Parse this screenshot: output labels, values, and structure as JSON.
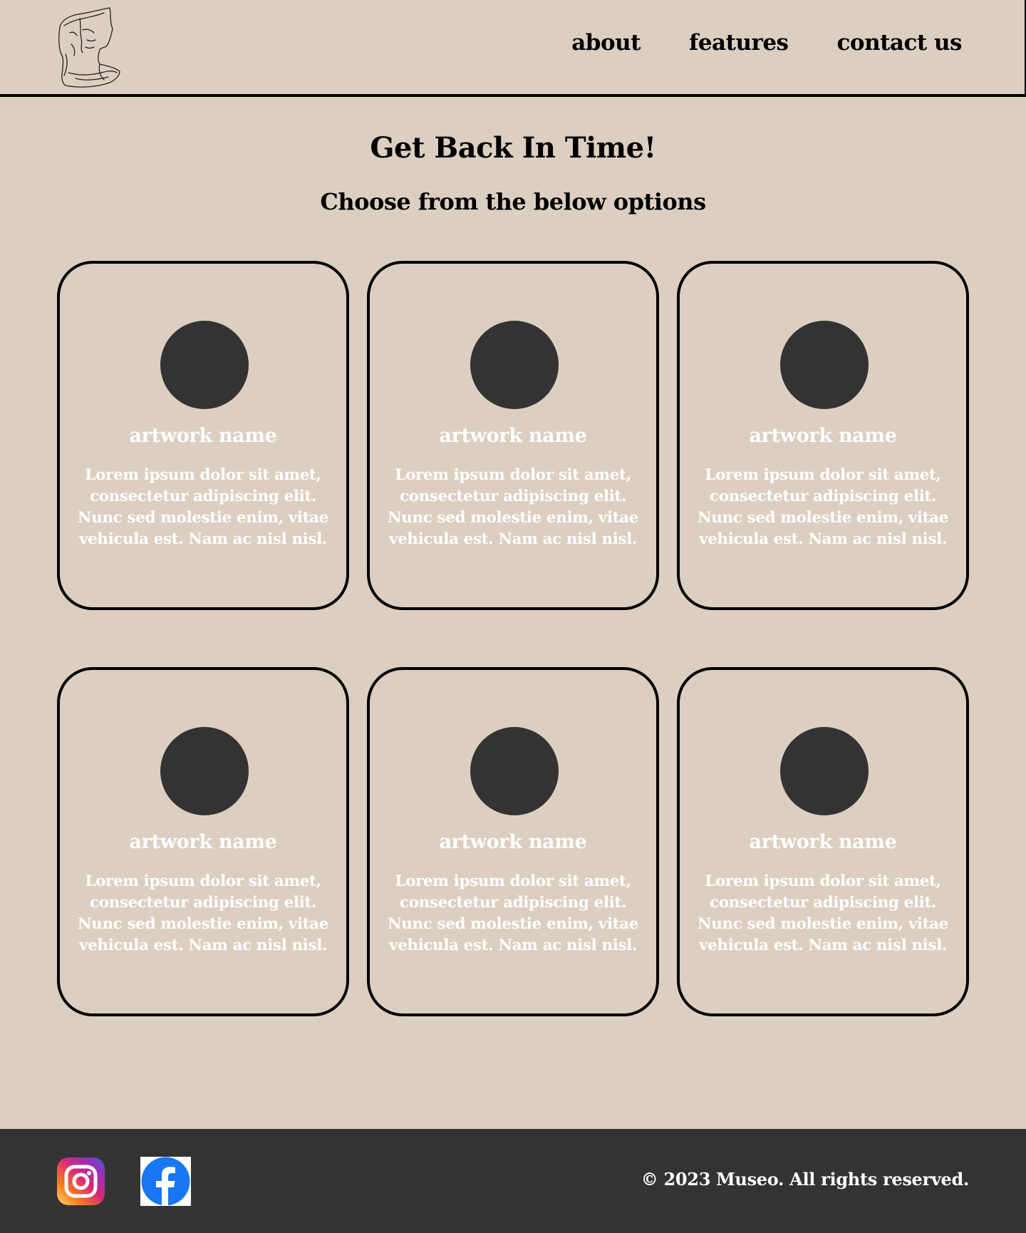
{
  "header": {
    "nav": [
      {
        "label": "about"
      },
      {
        "label": "features"
      },
      {
        "label": "contact us"
      }
    ]
  },
  "hero": {
    "title": "Get Back In Time!",
    "subtitle": "Choose from the below options"
  },
  "cards": [
    {
      "name": "artwork name",
      "description": "Lorem ipsum dolor sit amet, consectetur adipiscing elit. Nunc sed molestie enim, vitae vehicula est. Nam ac nisl nisl."
    },
    {
      "name": "artwork name",
      "description": "Lorem ipsum dolor sit amet, consectetur adipiscing elit. Nunc sed molestie enim, vitae vehicula est. Nam ac nisl nisl."
    },
    {
      "name": "artwork name",
      "description": "Lorem ipsum dolor sit amet, consectetur adipiscing elit. Nunc sed molestie enim, vitae vehicula est. Nam ac nisl nisl."
    },
    {
      "name": "artwork name",
      "description": "Lorem ipsum dolor sit amet, consectetur adipiscing elit. Nunc sed molestie enim, vitae vehicula est. Nam ac nisl nisl."
    },
    {
      "name": "artwork name",
      "description": "Lorem ipsum dolor sit amet, consectetur adipiscing elit. Nunc sed molestie enim, vitae vehicula est. Nam ac nisl nisl."
    },
    {
      "name": "artwork name",
      "description": "Lorem ipsum dolor sit amet, consectetur adipiscing elit. Nunc sed molestie enim, vitae vehicula est. Nam ac nisl nisl."
    }
  ],
  "footer": {
    "icons": [
      "instagram-icon",
      "facebook-icon"
    ],
    "copyright": "© 2023 Museo. All rights reserved."
  },
  "colors": {
    "background": "#dccfc1",
    "dark": "#333333",
    "text_light": "#ffffff",
    "facebook": "#1877f2"
  }
}
